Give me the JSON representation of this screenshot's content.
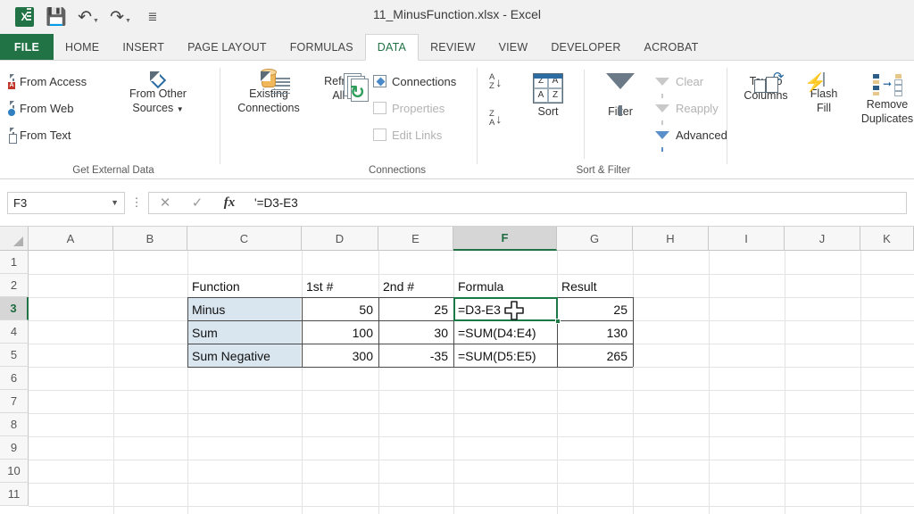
{
  "window": {
    "title": "11_MinusFunction.xlsx - Excel",
    "quick_access": [
      {
        "name": "excel-logo",
        "label": "X"
      },
      {
        "name": "save-icon",
        "label": "Ὃe"
      },
      {
        "name": "undo-icon",
        "label": "↶"
      },
      {
        "name": "redo-icon",
        "label": "↷"
      },
      {
        "name": "customize-qat-icon",
        "label": "≡"
      }
    ]
  },
  "tabs": [
    {
      "label": "FILE",
      "active": false,
      "file": true
    },
    {
      "label": "HOME",
      "active": false
    },
    {
      "label": "INSERT",
      "active": false
    },
    {
      "label": "PAGE LAYOUT",
      "active": false
    },
    {
      "label": "FORMULAS",
      "active": false
    },
    {
      "label": "DATA",
      "active": true
    },
    {
      "label": "REVIEW",
      "active": false
    },
    {
      "label": "VIEW",
      "active": false
    },
    {
      "label": "DEVELOPER",
      "active": false
    },
    {
      "label": "ACROBAT",
      "active": false
    }
  ],
  "ribbon": {
    "groups": [
      {
        "name": "get-external-data",
        "label": "Get External Data",
        "items": [
          {
            "label": "From Access",
            "icon": "from-access-icon"
          },
          {
            "label": "From Web",
            "icon": "from-web-icon"
          },
          {
            "label": "From Text",
            "icon": "from-text-icon"
          },
          {
            "label_line1": "From Other",
            "label_line2": "Sources",
            "icon": "from-other-sources-icon",
            "dropdown": true
          }
        ]
      },
      {
        "name": "connections",
        "label": "Connections",
        "items": [
          {
            "label_line1": "Existing",
            "label_line2": "Connections",
            "icon": "existing-connections-icon"
          },
          {
            "label_line1": "Refresh",
            "label_line2": "All",
            "icon": "refresh-all-icon",
            "dropdown": true
          },
          {
            "label": "Connections",
            "icon": "connections-icon",
            "disabled": false
          },
          {
            "label": "Properties",
            "icon": "properties-icon",
            "disabled": true
          },
          {
            "label": "Edit Links",
            "icon": "edit-links-icon",
            "disabled": true
          }
        ]
      },
      {
        "name": "sort-and-filter",
        "label": "Sort & Filter",
        "items": [
          {
            "label": "",
            "icon": "sort-ascending-icon"
          },
          {
            "label": "",
            "icon": "sort-descending-icon"
          },
          {
            "label": "Sort",
            "icon": "sort-icon"
          },
          {
            "label": "Filter",
            "icon": "filter-icon"
          },
          {
            "label": "Clear",
            "icon": "clear-filter-icon",
            "disabled": true
          },
          {
            "label": "Reapply",
            "icon": "reapply-filter-icon",
            "disabled": true
          },
          {
            "label": "Advanced",
            "icon": "advanced-filter-icon",
            "disabled": false
          }
        ]
      },
      {
        "name": "data-tools",
        "label": "",
        "items": [
          {
            "label_line1": "Text to",
            "label_line2": "Columns",
            "icon": "text-to-columns-icon"
          },
          {
            "label_line1": "Flash",
            "label_line2": "Fill",
            "icon": "flash-fill-icon"
          },
          {
            "label_line1": "Remove",
            "label_line2": "Duplicates",
            "icon": "remove-duplicates-icon"
          }
        ]
      }
    ]
  },
  "formula_bar": {
    "name_box_value": "F3",
    "cancel_icon": "✕",
    "enter_icon": "✓",
    "function_icon": "fx",
    "formula_value": "'=D3-E3"
  },
  "grid": {
    "columns": [
      "A",
      "B",
      "C",
      "D",
      "E",
      "F",
      "G",
      "H",
      "I",
      "J",
      "K"
    ],
    "rows": [
      "1",
      "2",
      "3",
      "4",
      "5",
      "6",
      "7",
      "8",
      "9",
      "10",
      "11"
    ],
    "selected_cell": "F3",
    "selected_column": "F",
    "selected_row": "3",
    "cells": [
      {
        "ref": "C2",
        "col": "C",
        "row": "2",
        "value": "Function",
        "align": "left"
      },
      {
        "ref": "D2",
        "col": "D",
        "row": "2",
        "value": "1st #",
        "align": "left"
      },
      {
        "ref": "E2",
        "col": "E",
        "row": "2",
        "value": "2nd #",
        "align": "left"
      },
      {
        "ref": "F2",
        "col": "F",
        "row": "2",
        "value": "Formula",
        "align": "left"
      },
      {
        "ref": "G2",
        "col": "G",
        "row": "2",
        "value": "Result",
        "align": "left"
      },
      {
        "ref": "C3",
        "col": "C",
        "row": "3",
        "value": "Minus",
        "align": "left",
        "fill": true
      },
      {
        "ref": "D3",
        "col": "D",
        "row": "3",
        "value": "50",
        "align": "right"
      },
      {
        "ref": "E3",
        "col": "E",
        "row": "3",
        "value": "25",
        "align": "right"
      },
      {
        "ref": "F3",
        "col": "F",
        "row": "3",
        "value": "=D3-E3",
        "align": "left"
      },
      {
        "ref": "G3",
        "col": "G",
        "row": "3",
        "value": "25",
        "align": "right"
      },
      {
        "ref": "C4",
        "col": "C",
        "row": "4",
        "value": "Sum",
        "align": "left",
        "fill": true
      },
      {
        "ref": "D4",
        "col": "D",
        "row": "4",
        "value": "100",
        "align": "right"
      },
      {
        "ref": "E4",
        "col": "E",
        "row": "4",
        "value": "30",
        "align": "right"
      },
      {
        "ref": "F4",
        "col": "F",
        "row": "4",
        "value": "=SUM(D4:E4)",
        "align": "left"
      },
      {
        "ref": "G4",
        "col": "G",
        "row": "4",
        "value": "130",
        "align": "right"
      },
      {
        "ref": "C5",
        "col": "C",
        "row": "5",
        "value": "Sum Negative",
        "align": "left",
        "fill": true
      },
      {
        "ref": "D5",
        "col": "D",
        "row": "5",
        "value": "300",
        "align": "right"
      },
      {
        "ref": "E5",
        "col": "E",
        "row": "5",
        "value": "-35",
        "align": "right"
      },
      {
        "ref": "F5",
        "col": "F",
        "row": "5",
        "value": "=SUM(D5:E5)",
        "align": "left"
      },
      {
        "ref": "G5",
        "col": "G",
        "row": "5",
        "value": "265",
        "align": "right"
      }
    ]
  },
  "colors": {
    "excel_green": "#217346",
    "selection_green": "#1a7a45",
    "header_fill": "#d9e6f0",
    "ribbon_bg": "#ffffff",
    "titlebar_bg": "#f1f1f1"
  }
}
